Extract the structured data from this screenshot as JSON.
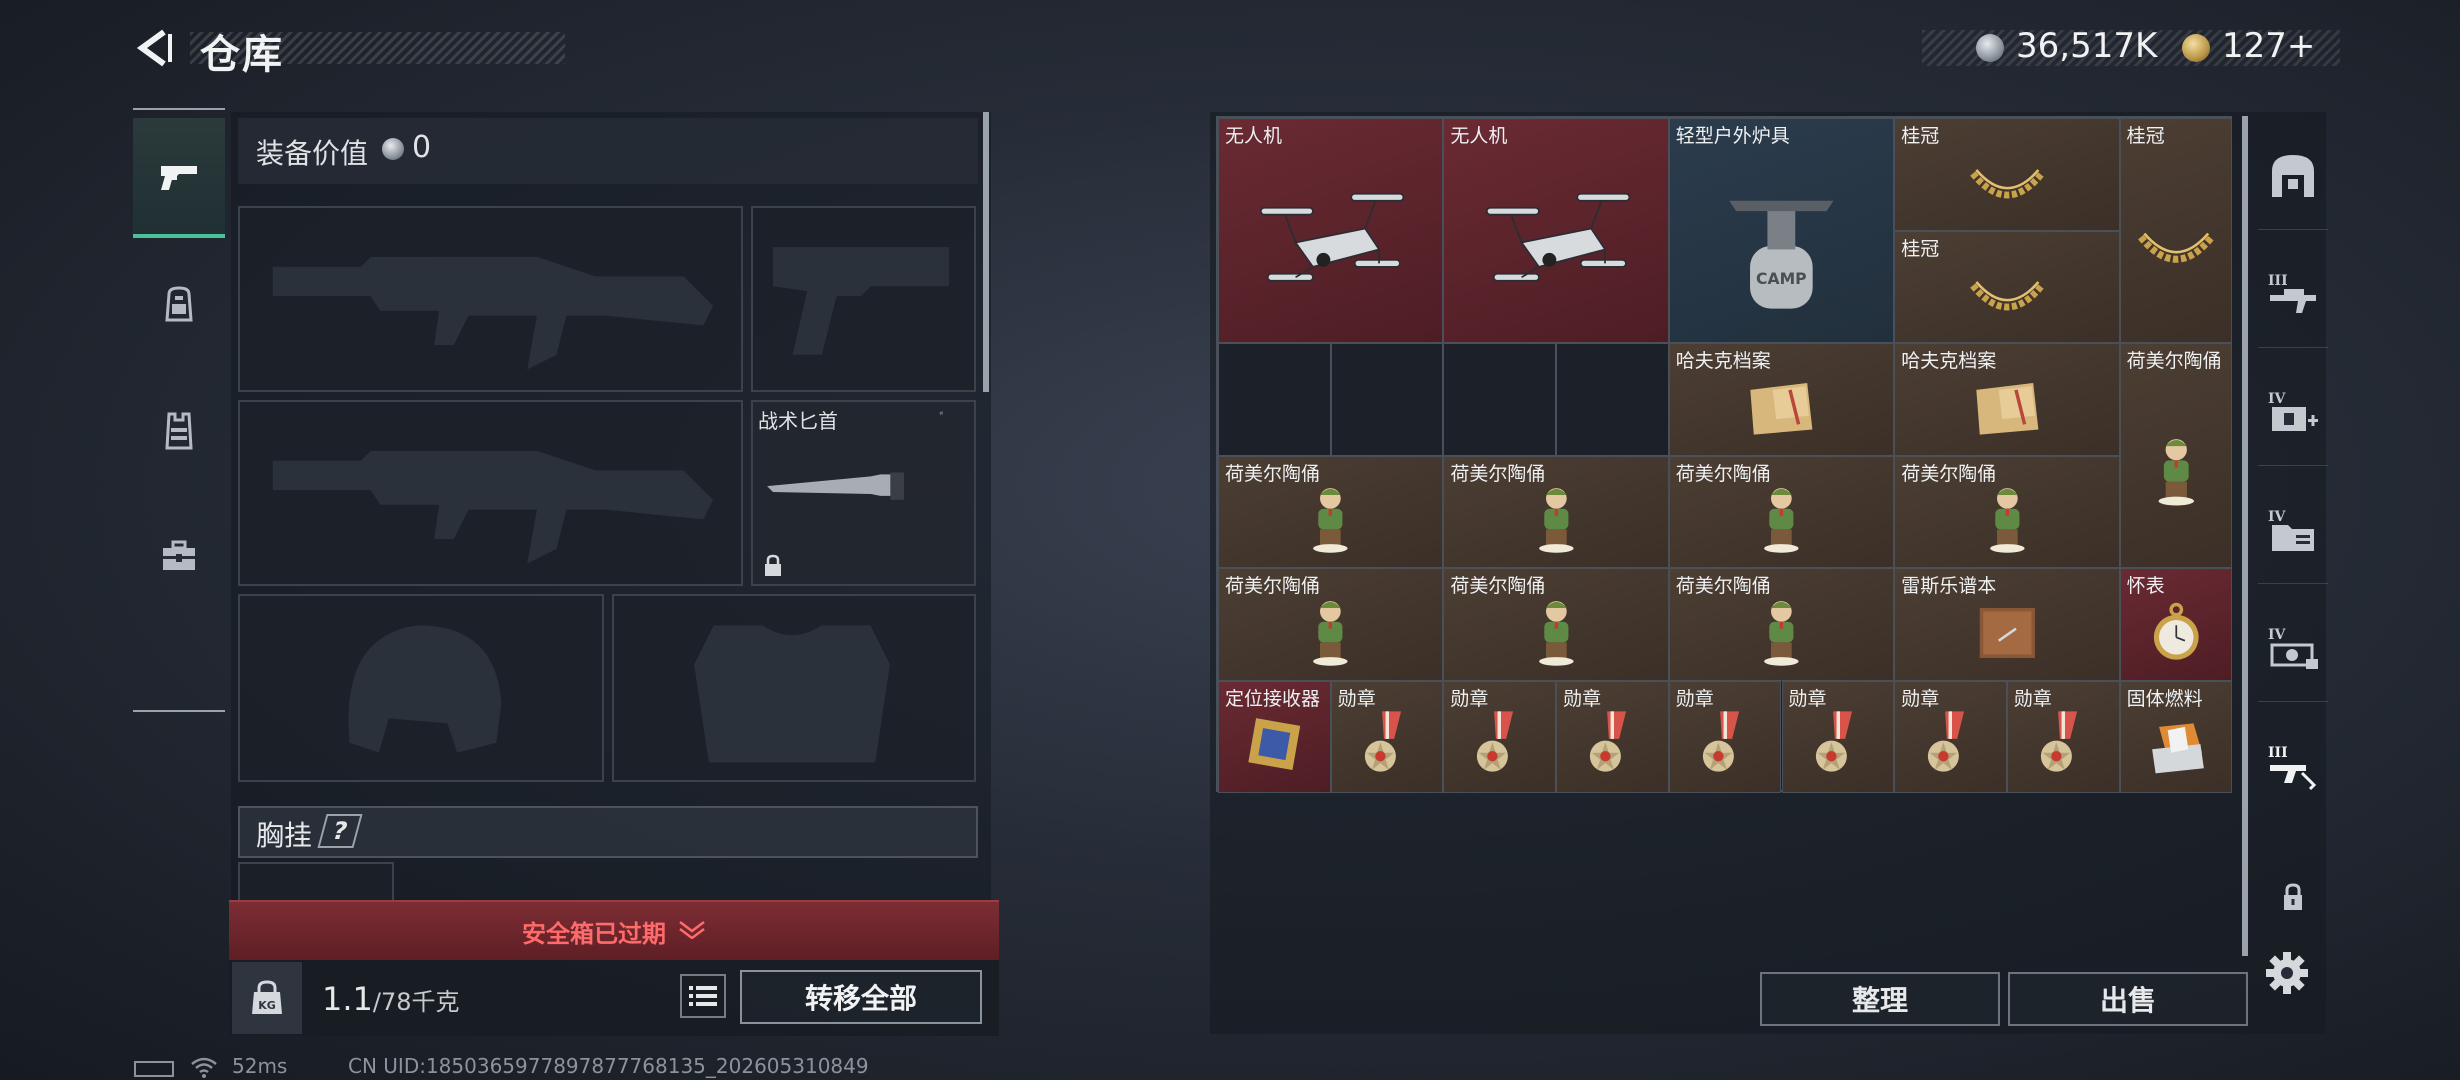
{
  "header": {
    "title": "仓库",
    "money": "36,517K",
    "gold": "127+",
    "back_icon": "back-arrow-icon",
    "silver_coin_icon": "silver-coin-icon",
    "gold_coin_icon": "gold-coin-icon"
  },
  "equipment": {
    "value_label": "装备价值",
    "value": "0",
    "knife_label": "战术匕首",
    "chest_rig_label": "胸挂",
    "chest_rig_help": "?",
    "safe_box_status": "安全箱已过期",
    "weight_current": "1.1",
    "weight_max": "/78千克",
    "transfer_all_label": "转移全部",
    "slots": [
      "primary-weapon-1",
      "pistol",
      "primary-weapon-2",
      "melee",
      "helmet",
      "armor"
    ]
  },
  "left_tabs": [
    {
      "name": "pistol-icon",
      "active": true
    },
    {
      "name": "backpack-icon",
      "active": false
    },
    {
      "name": "vest-icon",
      "active": false
    },
    {
      "name": "toolbox-icon",
      "active": false
    }
  ],
  "storage": {
    "sort_label": "整理",
    "sell_label": "出售",
    "items": [
      {
        "label": "无人机",
        "bg": "red",
        "icon": "drone-icon"
      },
      {
        "label": "无人机",
        "bg": "red",
        "icon": "drone-icon"
      },
      {
        "label": "轻型户外炉具",
        "bg": "blue",
        "icon": "camp-stove-icon",
        "brand": "CAMP"
      },
      {
        "label": "桂冠",
        "bg": "brown",
        "icon": "laurel-crown-icon"
      },
      {
        "label": "桂冠",
        "bg": "brown",
        "icon": "laurel-crown-icon"
      },
      {
        "label": "桂冠",
        "bg": "brown",
        "icon": "laurel-crown-icon"
      },
      {
        "label": "哈夫克档案",
        "bg": "brown",
        "icon": "document-folder-icon"
      },
      {
        "label": "哈夫克档案",
        "bg": "brown",
        "icon": "document-folder-icon"
      },
      {
        "label": "荷美尔陶俑",
        "bg": "brown",
        "icon": "figurine-icon"
      },
      {
        "label": "荷美尔陶俑",
        "bg": "brown",
        "icon": "figurine-icon"
      },
      {
        "label": "荷美尔陶俑",
        "bg": "brown",
        "icon": "figurine-icon"
      },
      {
        "label": "荷美尔陶俑",
        "bg": "brown",
        "icon": "figurine-icon"
      },
      {
        "label": "荷美尔陶俑",
        "bg": "brown",
        "icon": "figurine-icon"
      },
      {
        "label": "荷美尔陶俑",
        "bg": "brown",
        "icon": "figurine-icon"
      },
      {
        "label": "荷美尔陶俑",
        "bg": "brown",
        "icon": "figurine-icon"
      },
      {
        "label": "荷美尔陶俑",
        "bg": "brown",
        "icon": "figurine-icon"
      },
      {
        "label": "雷斯乐谱本",
        "bg": "brown",
        "icon": "music-book-icon"
      },
      {
        "label": "怀表",
        "bg": "red",
        "icon": "pocket-watch-icon"
      },
      {
        "label": "定位接收器",
        "bg": "red",
        "icon": "gps-receiver-icon"
      },
      {
        "label": "勋章",
        "bg": "brown",
        "icon": "medal-icon"
      },
      {
        "label": "勋章",
        "bg": "brown",
        "icon": "medal-icon"
      },
      {
        "label": "勋章",
        "bg": "brown",
        "icon": "medal-icon"
      },
      {
        "label": "勋章",
        "bg": "brown",
        "icon": "medal-icon"
      },
      {
        "label": "勋章",
        "bg": "brown",
        "icon": "medal-icon"
      },
      {
        "label": "勋章",
        "bg": "brown",
        "icon": "medal-icon"
      },
      {
        "label": "勋章",
        "bg": "brown",
        "icon": "medal-icon"
      },
      {
        "label": "固体燃料",
        "bg": "brown",
        "icon": "solid-fuel-icon"
      }
    ]
  },
  "right_tabs": [
    {
      "name": "safehouse-icon",
      "level": ""
    },
    {
      "name": "workbench-icon",
      "level": "III"
    },
    {
      "name": "medical-icon",
      "level": "IV"
    },
    {
      "name": "folder-icon",
      "level": "IV"
    },
    {
      "name": "money-icon",
      "level": "IV"
    },
    {
      "name": "ammo-icon",
      "level": "III"
    }
  ],
  "status": {
    "ping": "52ms",
    "uid": "CN UID:1850365977897877768135_202605310849"
  },
  "colors": {
    "accent_green": "#49c29a",
    "expired_red": "#ff6a6a",
    "rare_red": "#5c232b",
    "epic_brown": "#45392f",
    "common_blue": "#27384a"
  }
}
